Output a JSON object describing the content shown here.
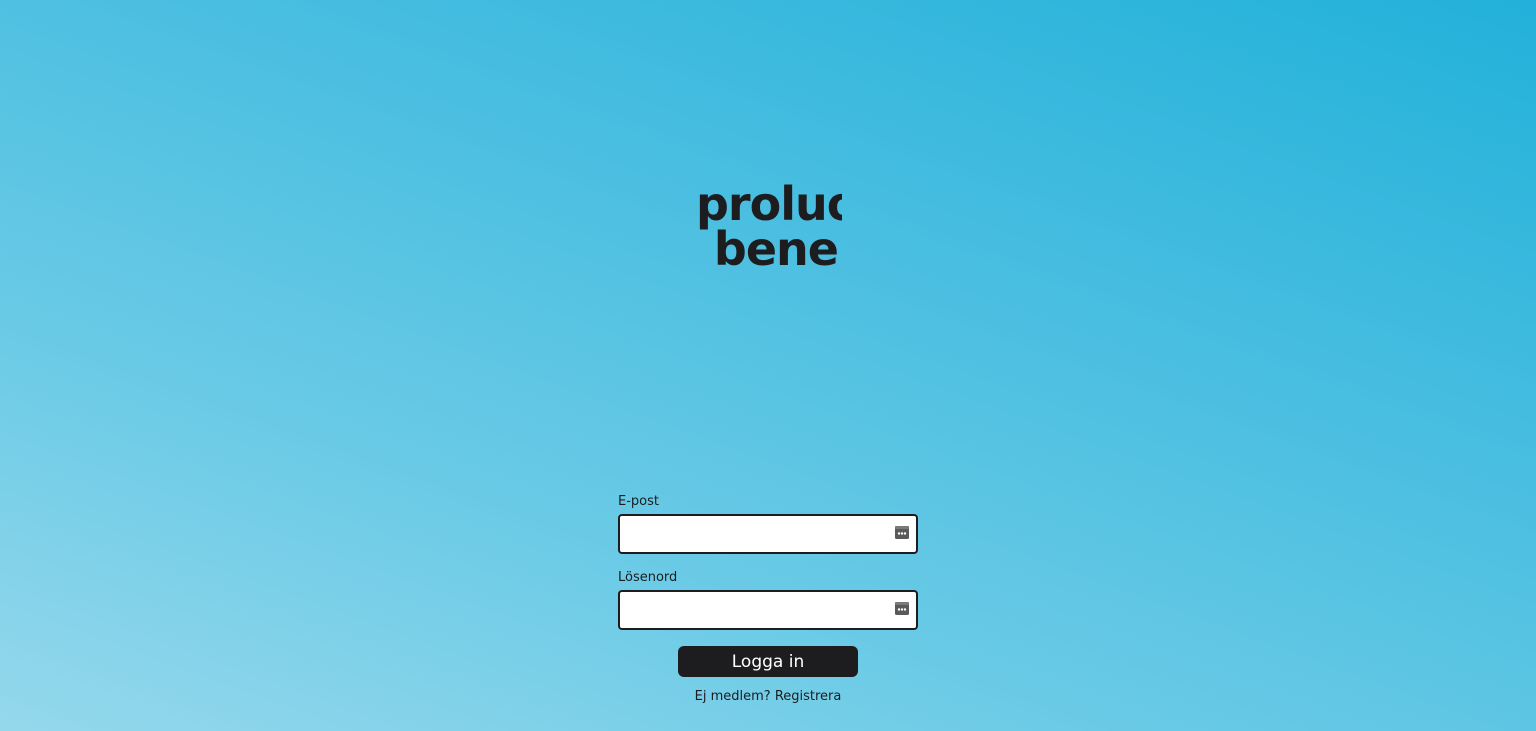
{
  "logo": {
    "line1": "proluo",
    "line2": "bene"
  },
  "form": {
    "email_label": "E-post",
    "email_value": "",
    "password_label": "Lösenord",
    "password_value": "",
    "login_label": "Logga in",
    "register_prompt": "Ej medlem?",
    "register_link": "Registrera"
  },
  "colors": {
    "background_light": "#95d8ec",
    "background_dark": "#22b1da",
    "text": "#1d1d1f",
    "button": "#1d1d1f",
    "button_text": "#ffffff",
    "logo_dot": "#f3e2d6"
  },
  "icons": {
    "email_field_icon": "password-manager-key-icon",
    "password_field_icon": "password-manager-key-icon"
  }
}
